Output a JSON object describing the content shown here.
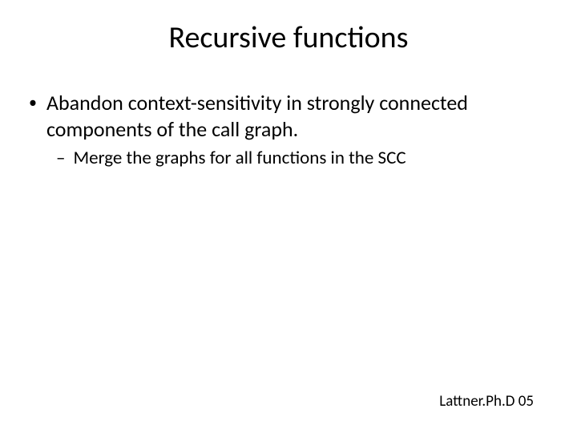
{
  "title": "Recursive functions",
  "bullets": {
    "lvl1": {
      "marker": "•",
      "text": "Abandon context-sensitivity in strongly connected components of the call graph."
    },
    "lvl2": {
      "marker": "–",
      "text": "Merge the graphs for all functions in the SCC"
    }
  },
  "citation": "Lattner.Ph.D 05"
}
